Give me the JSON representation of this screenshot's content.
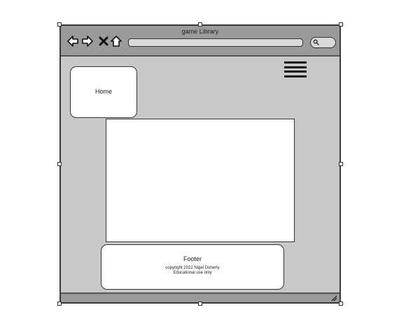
{
  "window": {
    "title": "game Library"
  },
  "toolbar": {
    "back_icon": "back-arrow-icon",
    "forward_icon": "forward-arrow-icon",
    "stop_icon": "close-icon",
    "home_icon": "home-icon",
    "address_value": "",
    "search_icon": "search-icon"
  },
  "menu": {
    "icon": "hamburger-menu-icon"
  },
  "home": {
    "label": "Home"
  },
  "footer": {
    "title": "Footer",
    "copyright": "copyright 2022 Nigel Doherty",
    "note": "Educational use only"
  },
  "colors": {
    "chrome": "#9a9a9a",
    "content_bg": "#c8c8c8",
    "panel": "#ffffff",
    "stroke": "#333333"
  }
}
